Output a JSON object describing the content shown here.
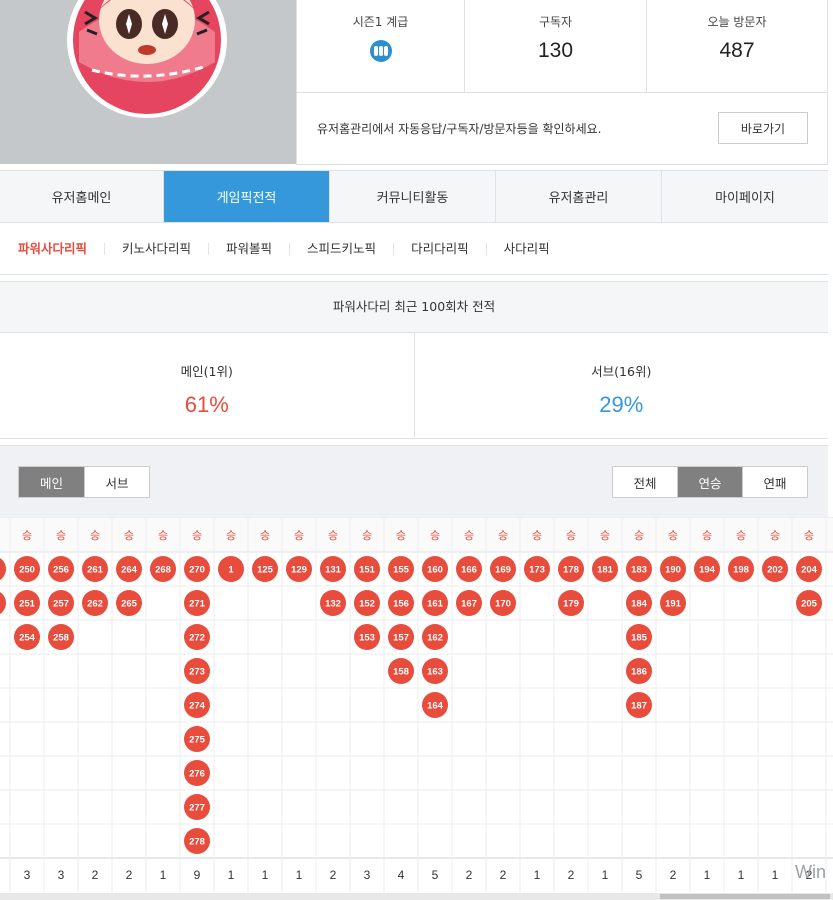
{
  "stats": {
    "grade_label": "시즌1 계급",
    "grade_icon": "diamond-grade-icon",
    "subscribers_label": "구독자",
    "subscribers": "130",
    "visitors_label": "오늘 방문자",
    "visitors": "487"
  },
  "notice": {
    "text": "유저홈관리에서 자동응답/구독자/방문자등을 확인하세요.",
    "button": "바로가기"
  },
  "main_tabs": [
    {
      "label": "유저홈메인",
      "active": false
    },
    {
      "label": "게임픽전적",
      "active": true
    },
    {
      "label": "커뮤니티활동",
      "active": false
    },
    {
      "label": "유저홈관리",
      "active": false
    },
    {
      "label": "마이페이지",
      "active": false
    }
  ],
  "sub_tabs": [
    {
      "label": "파워사다리픽",
      "active": true
    },
    {
      "label": "키노사다리픽",
      "active": false
    },
    {
      "label": "파워볼픽",
      "active": false
    },
    {
      "label": "스피드키노픽",
      "active": false
    },
    {
      "label": "다리다리픽",
      "active": false
    },
    {
      "label": "사다리픽",
      "active": false
    }
  ],
  "record": {
    "title": "파워사다리 최근 100회차 전적",
    "main_label": "메인(1위)",
    "main_pct": "61%",
    "sub_label": "서브(16위)",
    "sub_pct": "29%"
  },
  "filters": {
    "view": [
      {
        "label": "메인",
        "active": true
      },
      {
        "label": "서브",
        "active": false
      }
    ],
    "mode": [
      {
        "label": "전체",
        "active": false
      },
      {
        "label": "연승",
        "active": true
      },
      {
        "label": "연패",
        "active": false
      }
    ]
  },
  "colors": {
    "accent": "#3498db",
    "win": "#e74c3c",
    "sub_pct": "#3498db"
  },
  "streaks": {
    "header": "승",
    "columns": [
      {
        "values": [
          "",
          ""
        ],
        "count": ""
      },
      {
        "values": [
          "250",
          "251",
          "254"
        ],
        "count": "3"
      },
      {
        "values": [
          "256",
          "257",
          "258"
        ],
        "count": "3"
      },
      {
        "values": [
          "261",
          "262"
        ],
        "count": "2"
      },
      {
        "values": [
          "264",
          "265"
        ],
        "count": "2"
      },
      {
        "values": [
          "268"
        ],
        "count": "1"
      },
      {
        "values": [
          "270",
          "271",
          "272",
          "273",
          "274",
          "275",
          "276",
          "277",
          "278"
        ],
        "count": "9"
      },
      {
        "values": [
          "1"
        ],
        "count": "1"
      },
      {
        "values": [
          "125"
        ],
        "count": "1"
      },
      {
        "values": [
          "129"
        ],
        "count": "1"
      },
      {
        "values": [
          "131",
          "132"
        ],
        "count": "2"
      },
      {
        "values": [
          "151",
          "152",
          "153"
        ],
        "count": "3"
      },
      {
        "values": [
          "155",
          "156",
          "157",
          "158"
        ],
        "count": "4"
      },
      {
        "values": [
          "160",
          "161",
          "162",
          "163",
          "164"
        ],
        "count": "5"
      },
      {
        "values": [
          "166",
          "167"
        ],
        "count": "2"
      },
      {
        "values": [
          "169",
          "170"
        ],
        "count": "2"
      },
      {
        "values": [
          "173"
        ],
        "count": "1"
      },
      {
        "values": [
          "178",
          "179"
        ],
        "count": "2"
      },
      {
        "values": [
          "181"
        ],
        "count": "1"
      },
      {
        "values": [
          "183",
          "184",
          "185",
          "186",
          "187"
        ],
        "count": "5"
      },
      {
        "values": [
          "190",
          "191"
        ],
        "count": "2"
      },
      {
        "values": [
          "194"
        ],
        "count": "1"
      },
      {
        "values": [
          "198"
        ],
        "count": "1"
      },
      {
        "values": [
          "202"
        ],
        "count": "1"
      },
      {
        "values": [
          "204",
          "205"
        ],
        "count": "2"
      }
    ]
  }
}
